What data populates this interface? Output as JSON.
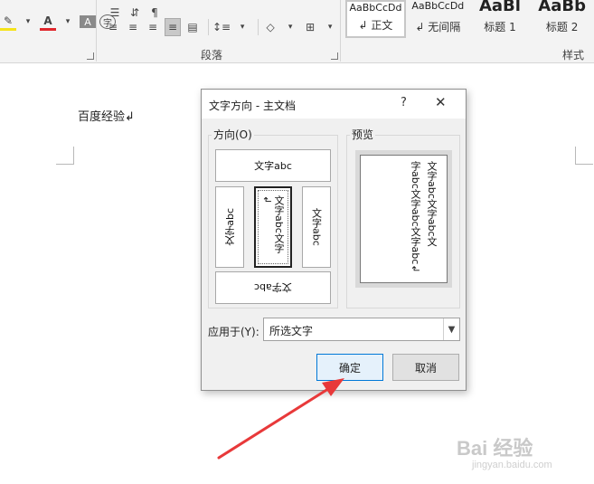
{
  "ribbon": {
    "font_tools": [
      "A",
      "A",
      "字"
    ],
    "para_group_label": "段落",
    "styles_group_label": "样式",
    "style_cards": [
      {
        "preview": "AaBbCcDd",
        "name": "↲ 正文",
        "selected": true
      },
      {
        "preview": "AaBbCcDd",
        "name": "↲ 无间隔",
        "selected": false
      },
      {
        "preview": "AaBl",
        "name": "标题 1",
        "selected": false,
        "big": true
      },
      {
        "preview": "AaBb",
        "name": "标题 2",
        "selected": false,
        "big": true
      }
    ],
    "colors": {
      "font_red": "#e0262c",
      "highlight_yellow": "#f5e31b",
      "selected_bg": "#c8c8c8"
    }
  },
  "document": {
    "text": "百度经验↲"
  },
  "dialog": {
    "title": "文字方向 - 主文档",
    "help": "?",
    "close": "✕",
    "orientation_label": "方向(O)",
    "preview_label": "预览",
    "options": [
      {
        "text": "文字abc",
        "orientation": "horizontal"
      },
      {
        "text": "文字abc",
        "orientation": "rotated-left"
      },
      {
        "text": "文字abc文字↲",
        "orientation": "vertical-stacked",
        "selected": true
      },
      {
        "text": "文字abc",
        "orientation": "rotated-right"
      },
      {
        "text": "文字abc",
        "orientation": "horizontal-flipped"
      }
    ],
    "preview_lines": [
      "文字abc文字abc文",
      "字abc文字abc文字abc↲"
    ],
    "apply_label": "应用于(Y):",
    "apply_value": "所选文字",
    "ok": "确定",
    "cancel": "取消",
    "accent": "#0078d7"
  },
  "annotation": {
    "arrow_color": "#e8393a"
  },
  "watermark": {
    "brand": "Bai 经验",
    "url": "jingyan.baidu.com"
  }
}
